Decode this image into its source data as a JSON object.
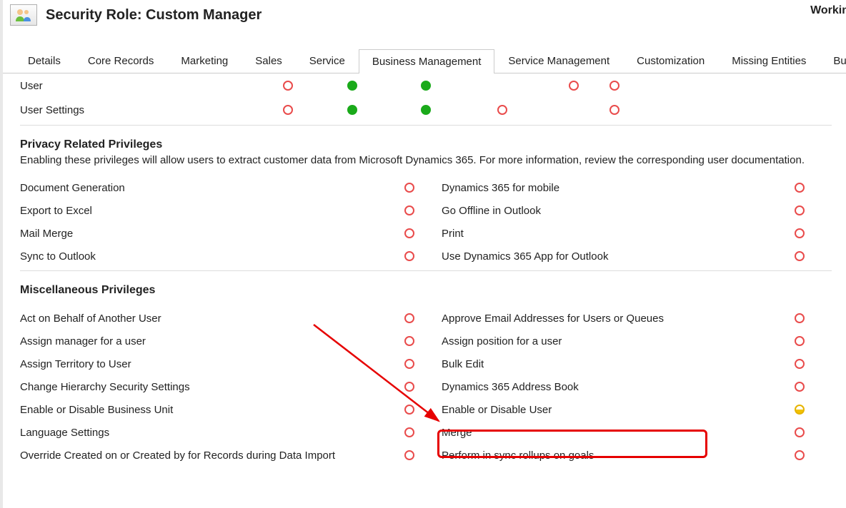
{
  "header": {
    "title": "Security Role: Custom Manager",
    "working": "Workin"
  },
  "tabs": [
    "Details",
    "Core Records",
    "Marketing",
    "Sales",
    "Service",
    "Business Management",
    "Service Management",
    "Customization",
    "Missing Entities",
    "Business Process F"
  ],
  "entities": [
    {
      "name": "User",
      "privs": [
        "none",
        "full",
        "full",
        "",
        "none",
        "none"
      ]
    },
    {
      "name": "User Settings",
      "privs": [
        "none",
        "full",
        "full",
        "none",
        "",
        "none"
      ]
    }
  ],
  "sections": {
    "privacy": {
      "title": "Privacy Related Privileges",
      "desc": "Enabling these privileges will allow users to extract customer data from Microsoft Dynamics 365. For more information, review the corresponding user documentation.",
      "left": [
        "Document Generation",
        "Export to Excel",
        "Mail Merge",
        "Sync to Outlook"
      ],
      "left_states": [
        "none",
        "none",
        "none",
        "none"
      ],
      "right": [
        "Dynamics 365 for mobile",
        "Go Offline in Outlook",
        "Print",
        "Use Dynamics 365 App for Outlook"
      ],
      "right_states": [
        "none",
        "none",
        "none",
        "none"
      ]
    },
    "misc": {
      "title": "Miscellaneous Privileges",
      "left": [
        "Act on Behalf of Another User",
        "Assign manager for a user",
        "Assign Territory to User",
        "Change Hierarchy Security Settings",
        "Enable or Disable Business Unit",
        "Language Settings",
        "Override Created on or Created by for Records during Data Import"
      ],
      "left_states": [
        "none",
        "none",
        "none",
        "none",
        "none",
        "none",
        "none"
      ],
      "right": [
        "Approve Email Addresses for Users or Queues",
        "Assign position for a user",
        "Bulk Edit",
        "Dynamics 365 Address Book",
        "Enable or Disable User",
        "Merge",
        "Perform in sync rollups on goals"
      ],
      "right_states": [
        "none",
        "none",
        "none",
        "none",
        "half",
        "none",
        "none"
      ]
    }
  },
  "annotation": {
    "highlighted_privilege": "Enable or Disable User"
  },
  "colors": {
    "none_ring": "#e94b4b",
    "full": "#1aaa1a",
    "half": "#f2c200",
    "highlight": "#e60000"
  }
}
